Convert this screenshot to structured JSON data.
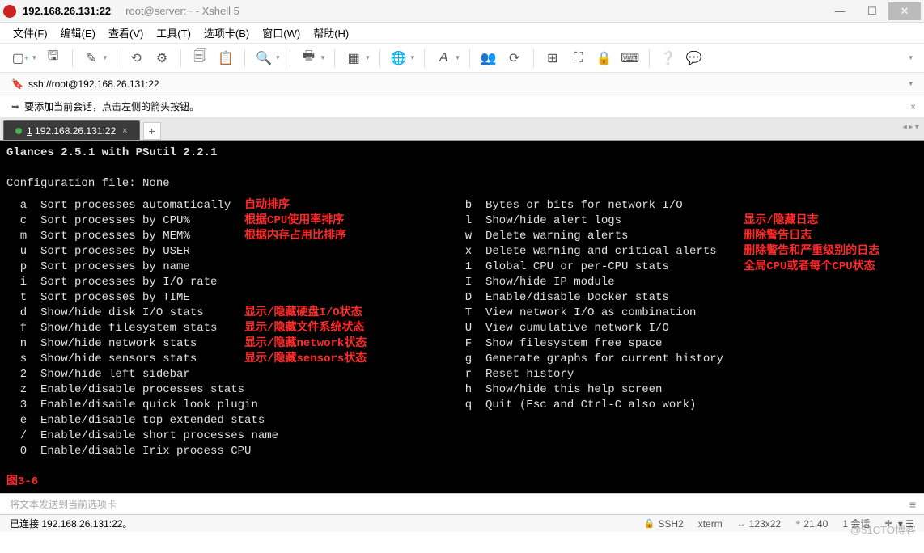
{
  "window": {
    "title_primary": "192.168.26.131:22",
    "title_secondary": "root@server:~ - Xshell 5"
  },
  "menu": {
    "file": "文件(F)",
    "edit": "编辑(E)",
    "view": "查看(V)",
    "tools": "工具(T)",
    "tabs": "选项卡(B)",
    "window": "窗口(W)",
    "help": "帮助(H)"
  },
  "addressbar": {
    "url": "ssh://root@192.168.26.131:22"
  },
  "hintbar": {
    "text": "要添加当前会话，点击左侧的箭头按钮。"
  },
  "tab": {
    "index": "1",
    "label": "192.168.26.131:22"
  },
  "terminal": {
    "header": "Glances 2.5.1 with PSutil 2.2.1",
    "config": "Configuration file: None",
    "left": [
      {
        "k": "a",
        "t": "Sort processes automatically",
        "ann": "自动排序"
      },
      {
        "k": "c",
        "t": "Sort processes by CPU%",
        "ann": "根据CPU使用率排序"
      },
      {
        "k": "m",
        "t": "Sort processes by MEM%",
        "ann": "根据内存占用比排序"
      },
      {
        "k": "u",
        "t": "Sort processes by USER",
        "ann": ""
      },
      {
        "k": "p",
        "t": "Sort processes by name",
        "ann": ""
      },
      {
        "k": "i",
        "t": "Sort processes by I/O rate",
        "ann": ""
      },
      {
        "k": "t",
        "t": "Sort processes by TIME",
        "ann": ""
      },
      {
        "k": "d",
        "t": "Show/hide disk I/O stats",
        "ann": "显示/隐藏硬盘I/O状态"
      },
      {
        "k": "f",
        "t": "Show/hide filesystem stats",
        "ann": "显示/隐藏文件系统状态"
      },
      {
        "k": "n",
        "t": "Show/hide network stats",
        "ann": "显示/隐藏network状态"
      },
      {
        "k": "s",
        "t": "Show/hide sensors stats",
        "ann": "显示/隐藏sensors状态"
      },
      {
        "k": "2",
        "t": "Show/hide left sidebar",
        "ann": ""
      },
      {
        "k": "z",
        "t": "Enable/disable processes stats",
        "ann": ""
      },
      {
        "k": "3",
        "t": "Enable/disable quick look plugin",
        "ann": ""
      },
      {
        "k": "e",
        "t": "Enable/disable top extended stats",
        "ann": ""
      },
      {
        "k": "/",
        "t": "Enable/disable short processes name",
        "ann": ""
      },
      {
        "k": "0",
        "t": "Enable/disable Irix process CPU",
        "ann": ""
      }
    ],
    "right": [
      {
        "k": "b",
        "t": "Bytes or bits for network I/O",
        "ann": ""
      },
      {
        "k": "l",
        "t": "Show/hide alert logs",
        "ann": "显示/隐藏日志"
      },
      {
        "k": "w",
        "t": "Delete warning alerts",
        "ann": "删除警告日志"
      },
      {
        "k": "x",
        "t": "Delete warning and critical alerts",
        "ann": "删除警告和严重级别的日志"
      },
      {
        "k": "1",
        "t": "Global CPU or per-CPU stats",
        "ann": "全局CPU或者每个CPU状态"
      },
      {
        "k": "I",
        "t": "Show/hide IP module",
        "ann": ""
      },
      {
        "k": "D",
        "t": "Enable/disable Docker stats",
        "ann": ""
      },
      {
        "k": "T",
        "t": "View network I/O as combination",
        "ann": ""
      },
      {
        "k": "U",
        "t": "View cumulative network I/O",
        "ann": ""
      },
      {
        "k": "F",
        "t": "Show filesystem free space",
        "ann": ""
      },
      {
        "k": "g",
        "t": "Generate graphs for current history",
        "ann": ""
      },
      {
        "k": "r",
        "t": "Reset history",
        "ann": ""
      },
      {
        "k": "h",
        "t": "Show/hide this help screen",
        "ann": ""
      },
      {
        "k": "q",
        "t": "Quit (Esc and Ctrl-C also work)",
        "ann": ""
      }
    ],
    "figure": "图3-6"
  },
  "sendbar": {
    "placeholder": "将文本发送到当前选项卡"
  },
  "status": {
    "conn": "已连接 192.168.26.131:22。",
    "proto": "SSH2",
    "termtype": "xterm",
    "size": "123x22",
    "pos": "21,40",
    "sess": "1 会话"
  },
  "watermark": "@51CTO博客"
}
